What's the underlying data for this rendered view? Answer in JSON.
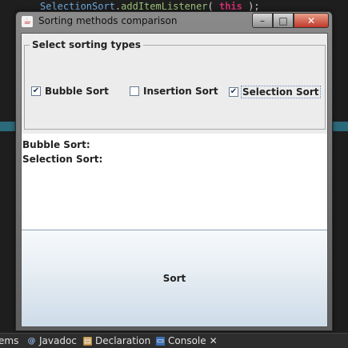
{
  "ide": {
    "code_object": "SelectionSort",
    "code_dot": ".",
    "code_method": "addItemListener",
    "code_open": "( ",
    "code_keyword": "this",
    "code_close": " );",
    "tabs": [
      {
        "label": "ems",
        "icon": "list-icon"
      },
      {
        "label": "Javadoc",
        "icon": "javadoc-icon"
      },
      {
        "label": "Declaration",
        "icon": "declaration-icon"
      },
      {
        "label": "Console",
        "icon": "console-icon"
      }
    ]
  },
  "window": {
    "title": "Sorting methods comparison",
    "minimize": "–",
    "maximize": "□",
    "close": "✕"
  },
  "panel": {
    "legend": "Select sorting types",
    "checkboxes": [
      {
        "label": "Bubble Sort",
        "checked": true
      },
      {
        "label": "Insertion Sort",
        "checked": false
      },
      {
        "label": "Selection Sort",
        "checked": true
      }
    ]
  },
  "results": [
    "Bubble Sort:",
    "Selection Sort:"
  ],
  "sort_button": "Sort"
}
